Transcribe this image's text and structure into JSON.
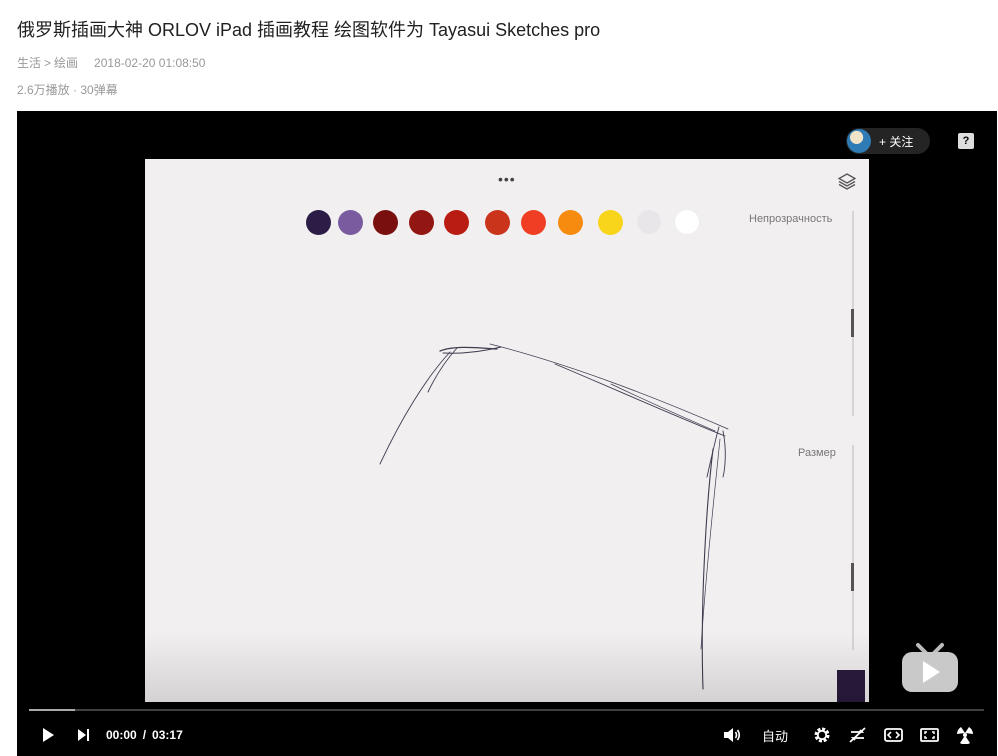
{
  "video": {
    "title": "俄罗斯插画大神 ORLOV iPad 插画教程 绘图软件为 Tayasui Sketches pro",
    "breadcrumb": [
      "生活",
      "绘画"
    ],
    "breadcrumb_separator": ">",
    "publish_time": "2018-02-20 01:08:50",
    "stats": "2.6万播放 · 30弹幕"
  },
  "player": {
    "follow_label": "+ 关注",
    "help_label": "?",
    "app_canvas": {
      "menu_icon": "more-dots-icon",
      "layers_icon": "layers-icon",
      "palette_colors": [
        "#2b1d45",
        "#7a5ba0",
        "#7a0f10",
        "#921612",
        "#b91c10",
        "#c9341b",
        "#ef3e23",
        "#f68b0f",
        "#f8d41a",
        "#e9e6e9",
        "#ffffff"
      ],
      "opacity_label": "Непрозрачность",
      "size_label": "Размер",
      "current_color": "#2a1b3d"
    },
    "controls": {
      "current_time": "00:00",
      "time_separator": "/",
      "duration": "03:17",
      "quality_label": "自动",
      "progress": 0,
      "accent_color": "#00a1d6"
    }
  }
}
